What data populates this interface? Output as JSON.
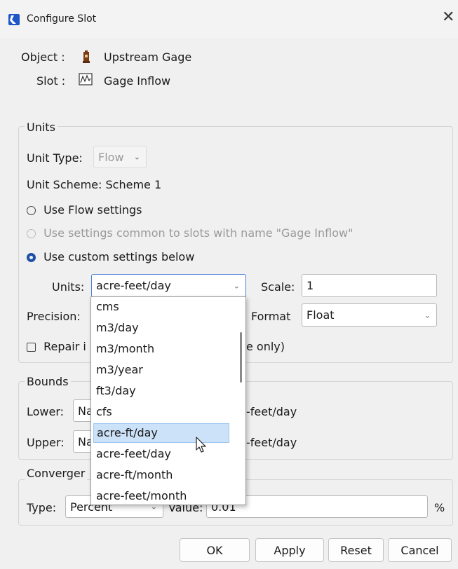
{
  "window": {
    "title": "Configure Slot",
    "close_glyph": "✕"
  },
  "object": {
    "label": "Object :",
    "name": "Upstream Gage",
    "icon": "gage-icon"
  },
  "slot": {
    "label": "Slot :",
    "name": "Gage Inflow",
    "icon": "series-slot-icon"
  },
  "units_group": {
    "legend": "Units",
    "unit_type_label": "Unit Type:",
    "unit_type_value": "Flow",
    "unit_scheme_text": "Unit Scheme: Scheme 1",
    "radio_flow": "Use Flow settings",
    "radio_common": "Use settings common to slots with name \"Gage Inflow\"",
    "radio_custom": "Use custom settings below",
    "units_label": "Units:",
    "units_value": "acre-feet/day",
    "scale_label": "Scale:",
    "scale_value": "1",
    "precision_label": "Precision:",
    "format_label": "Format",
    "format_value": "Float",
    "repair_label_start": "Repair i",
    "repair_label_end": "e only)"
  },
  "bounds_group": {
    "legend": "Bounds",
    "lower_label": "Lower:",
    "lower_value": "Na",
    "lower_units": "-feet/day",
    "upper_label": "Upper:",
    "upper_value": "Na",
    "upper_units": "-feet/day"
  },
  "convergence_group": {
    "legend": "Converger",
    "type_label": "Type:",
    "type_value": "Percent",
    "value_label": "Value:",
    "value_value": "0.01",
    "percent_sign": "%"
  },
  "units_dropdown": {
    "options": [
      "cms",
      "m3/day",
      "m3/month",
      "m3/year",
      "ft3/day",
      "cfs",
      "acre-ft/day",
      "acre-feet/day",
      "acre-ft/month",
      "acre-feet/month"
    ],
    "highlighted_index": 6
  },
  "buttons": {
    "ok": "OK",
    "apply": "Apply",
    "reset": "Reset",
    "cancel": "Cancel"
  },
  "colors": {
    "accent": "#1f4fa8",
    "highlight": "#cce2f8",
    "focus_border": "#4a7ed8"
  }
}
